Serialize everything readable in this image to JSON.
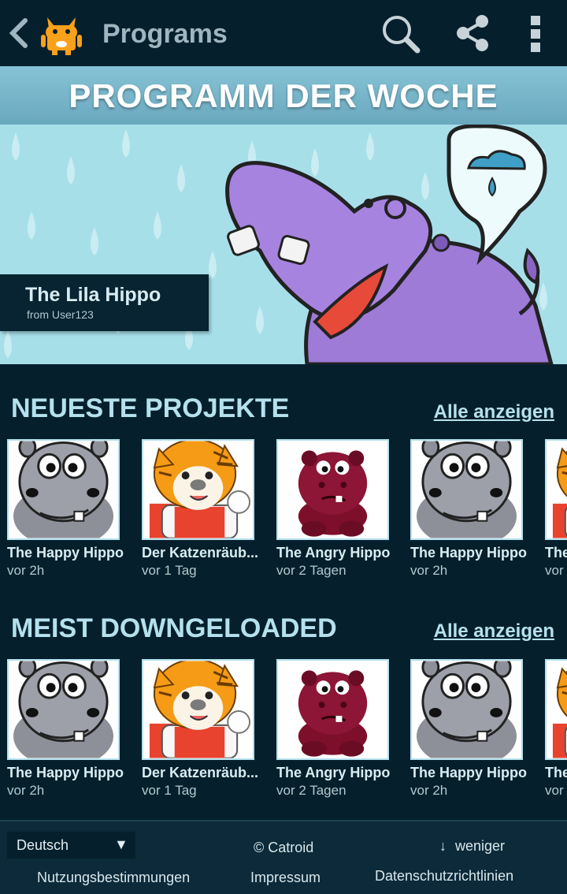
{
  "appbar": {
    "title": "Programs",
    "icons": {
      "back": "back-arrow-icon",
      "logo": "catroid-logo-icon",
      "search": "search-icon",
      "share": "share-icon",
      "more": "more-vert-icon"
    }
  },
  "featured": {
    "banner": "PROGRAMM DER WOCHE",
    "title": "The Lila Hippo",
    "author": "from User123"
  },
  "sections": [
    {
      "title": "NEUESTE PROJEKTE",
      "see_all": "Alle anzeigen",
      "items": [
        {
          "name": "The Happy Hippo",
          "time": "vor 2h"
        },
        {
          "name": "Der Katzenräub...",
          "time": "vor 1 Tag"
        },
        {
          "name": "The Angry Hippo",
          "time": "vor 2 Tagen"
        },
        {
          "name": "The Happy Hippo",
          "time": "vor 2h"
        },
        {
          "name": "The",
          "time": "vor"
        }
      ]
    },
    {
      "title": "MEIST DOWNGELOADED",
      "see_all": "Alle anzeigen",
      "items": [
        {
          "name": "The Happy Hippo",
          "time": "vor 2h"
        },
        {
          "name": "Der Katzenräub...",
          "time": "vor 1 Tag"
        },
        {
          "name": "The Angry Hippo",
          "time": "vor 2 Tagen"
        },
        {
          "name": "The Happy Hippo",
          "time": "vor 2h"
        },
        {
          "name": "The",
          "time": "vor"
        }
      ]
    }
  ],
  "footer": {
    "language": "Deutsch",
    "copyright": "© Catroid",
    "less": "weniger",
    "links": {
      "terms": "Nutzungsbestimmungen",
      "imprint": "Impressum",
      "privacy": "Datenschutzrichtlinien"
    }
  },
  "colors": {
    "background": "#05202c",
    "accent": "#b5e1ee",
    "banner": "#7ab7cb"
  }
}
